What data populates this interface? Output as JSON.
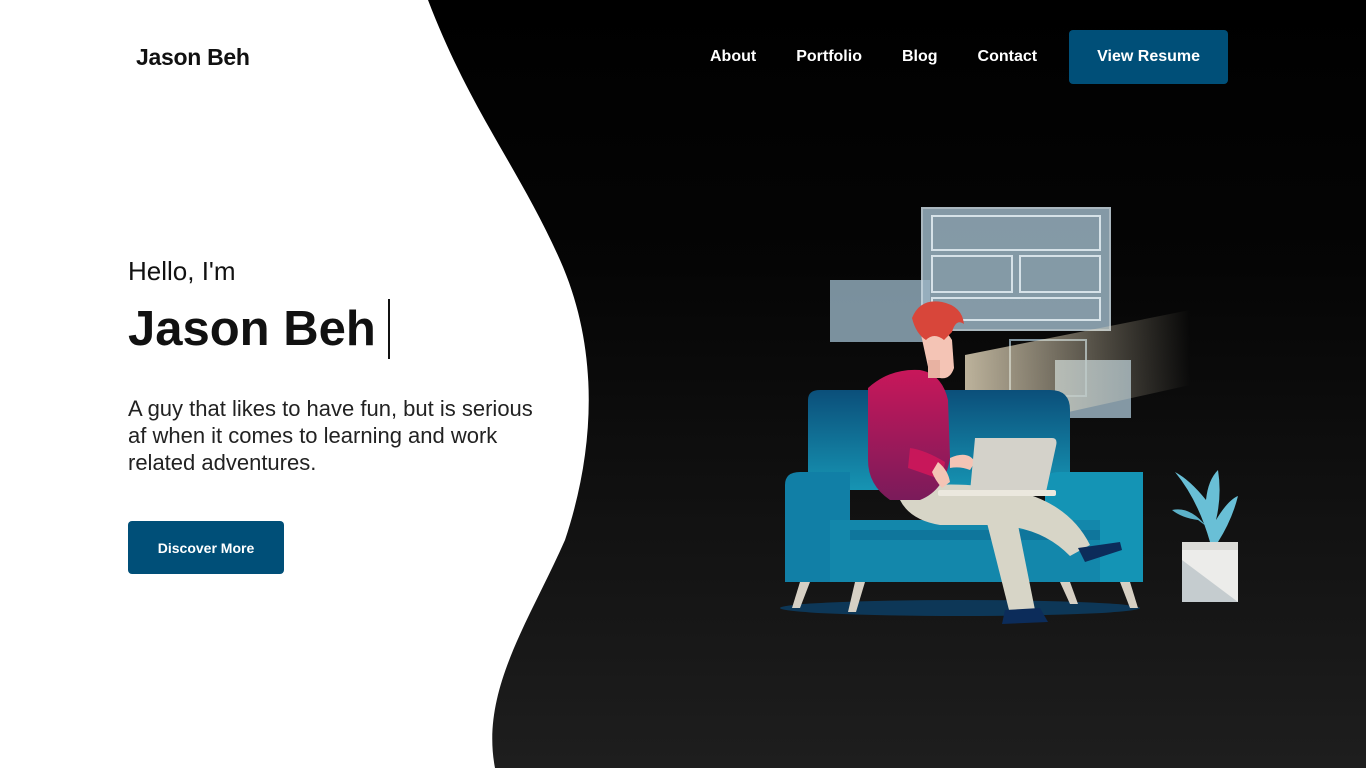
{
  "header": {
    "logo": "Jason Beh",
    "nav": [
      {
        "label": "About"
      },
      {
        "label": "Portfolio"
      },
      {
        "label": "Blog"
      },
      {
        "label": "Contact"
      }
    ],
    "resume_button": "View Resume"
  },
  "hero": {
    "greeting": "Hello, I'm",
    "name": "Jason Beh",
    "tagline": "A guy that likes to have fun, but is serious af when it comes to learning and work related adventures.",
    "cta": "Discover More"
  },
  "colors": {
    "accent": "#004f78",
    "dark_bg": "#000000",
    "text": "#111111"
  },
  "illustration": {
    "icon": "person-on-couch-with-laptop-illustration"
  }
}
